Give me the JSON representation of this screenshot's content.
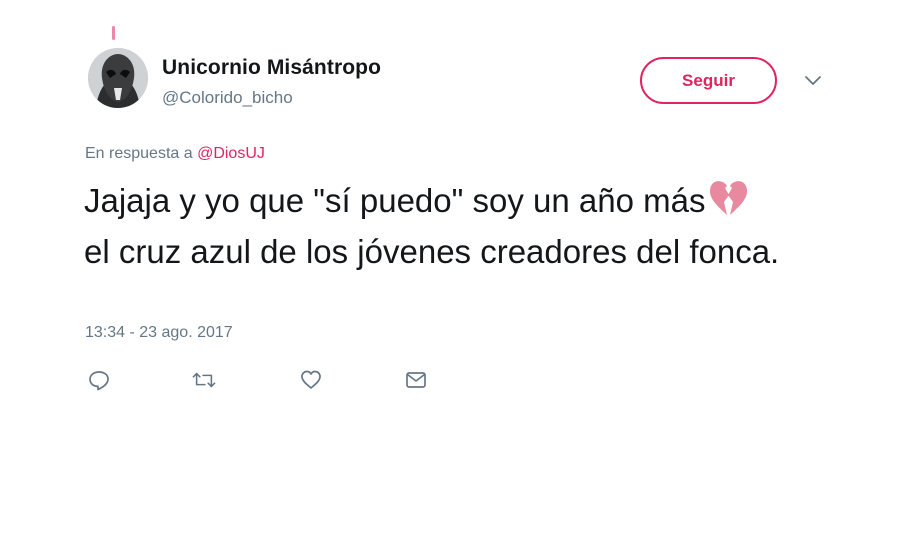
{
  "author": {
    "name": "Unicornio Misántropo",
    "handle": "@Colorido_bicho",
    "avatar_icon": "masked-figure-avatar"
  },
  "follow_button": {
    "label": "Seguir"
  },
  "reply": {
    "prefix": "En respuesta a ",
    "mention": "@DiosUJ"
  },
  "tweet": {
    "text": "Jajaja y yo que \"sí puedo\" soy un año más",
    "text_cont": "el cruz azul de los jóvenes creadores del fonca.",
    "emoji": "broken-heart-icon"
  },
  "timestamp": "13:34 - 23 ago. 2017",
  "actions": [
    "reply-icon",
    "retweet-icon",
    "like-icon",
    "message-icon"
  ],
  "colors": {
    "accent": "#e0245e",
    "secondary_text": "#657786",
    "primary_text": "#14171a",
    "icon": "#657786"
  }
}
